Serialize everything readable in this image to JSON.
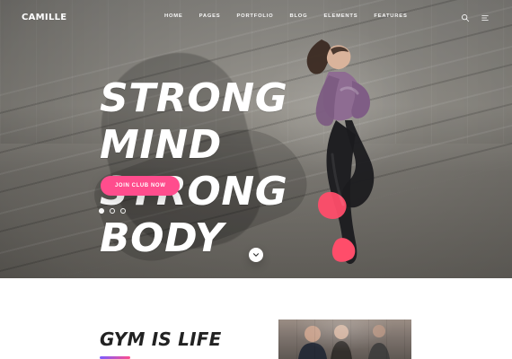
{
  "brand": {
    "name": "CAMILLE"
  },
  "nav": {
    "items": [
      {
        "label": "HOME"
      },
      {
        "label": "PAGES"
      },
      {
        "label": "PORTFOLIO"
      },
      {
        "label": "BLOG"
      },
      {
        "label": "ELEMENTS"
      },
      {
        "label": "FEATURES"
      }
    ]
  },
  "header_icons": {
    "search": {
      "name": "search-icon"
    },
    "menu": {
      "name": "menu-icon"
    }
  },
  "hero": {
    "headline_line1": "STRONG MIND",
    "headline_line2": "STRONG BODY",
    "cta_label": "JOIN CLUB NOW",
    "slider": {
      "total": 3,
      "active_index": 0
    },
    "scroll_icon": "chevron-down-icon"
  },
  "section": {
    "title": "GYM IS LIFE"
  },
  "colors": {
    "accent_pink": "#ff4d8d",
    "accent_purple": "#7b5cff"
  }
}
